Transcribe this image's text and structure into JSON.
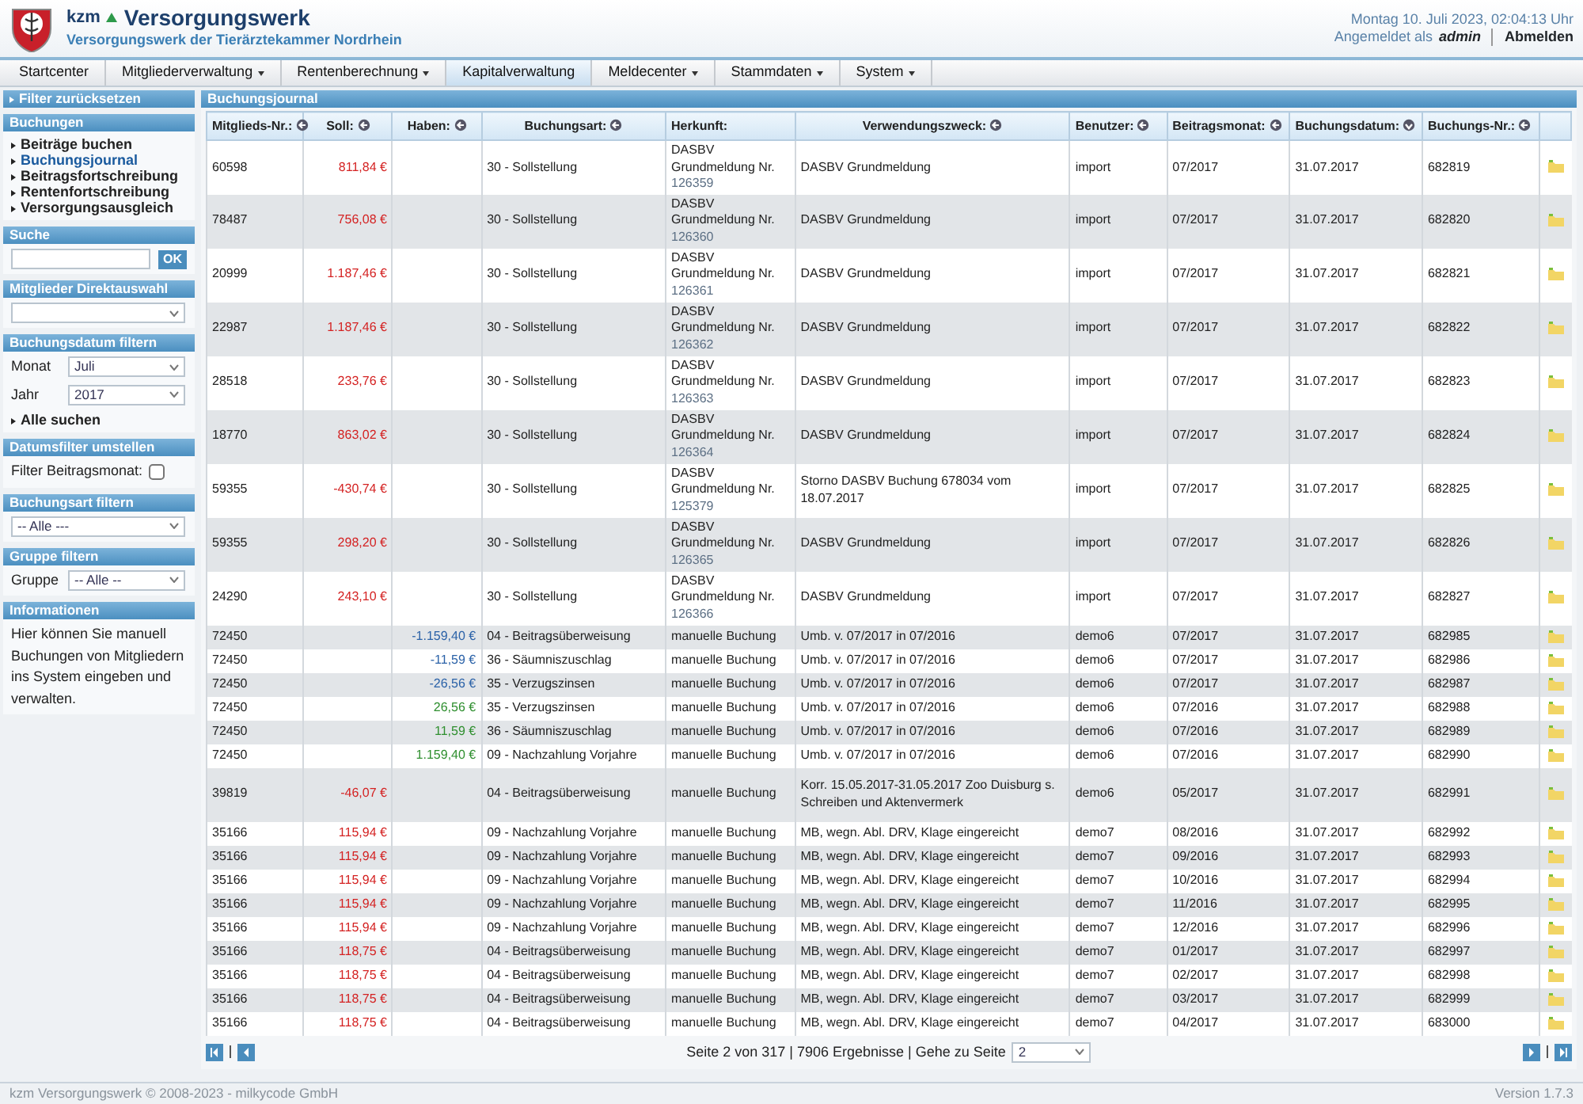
{
  "header": {
    "brand_short": "kzm",
    "brand_name": "Versorgungswerk",
    "subtitle": "Versorgungswerk der Tierärztekammer Nordrhein",
    "datetime": "Montag 10. Juli 2023, 02:04:13 Uhr",
    "login_label": "Angemeldet als",
    "login_user": "admin",
    "logout": "Abmelden"
  },
  "nav": [
    {
      "label": "Startcenter",
      "has_menu": false,
      "selected": false
    },
    {
      "label": "Mitgliederverwaltung",
      "has_menu": true,
      "selected": false
    },
    {
      "label": "Rentenberechnung",
      "has_menu": true,
      "selected": false
    },
    {
      "label": "Kapitalverwaltung",
      "has_menu": false,
      "selected": true
    },
    {
      "label": "Meldecenter",
      "has_menu": true,
      "selected": false
    },
    {
      "label": "Stammdaten",
      "has_menu": true,
      "selected": false
    },
    {
      "label": "System",
      "has_menu": true,
      "selected": false
    }
  ],
  "sidebar": {
    "reset": "Filter zurücksetzen",
    "sections": [
      {
        "kind": "links",
        "title": "Buchungen",
        "items": [
          {
            "label": "Beiträge buchen",
            "selected": false
          },
          {
            "label": "Buchungsjournal",
            "selected": true
          },
          {
            "label": "Beitragsfortschreibung",
            "selected": false
          },
          {
            "label": "Rentenfortschreibung",
            "selected": false
          },
          {
            "label": "Versorgungsausgleich",
            "selected": false
          }
        ]
      },
      {
        "kind": "search",
        "title": "Suche",
        "button": "OK"
      },
      {
        "kind": "combo",
        "title": "Mitglieder Direktauswahl"
      },
      {
        "kind": "date",
        "title": "Buchungsdatum filtern",
        "fields": [
          {
            "label": "Monat",
            "value": "Juli"
          },
          {
            "label": "Jahr",
            "value": "2017"
          }
        ],
        "link": "Alle suchen"
      },
      {
        "kind": "checkbox",
        "title": "Datumsfilter umstellen",
        "label": "Filter Beitragsmonat:",
        "checked": false
      },
      {
        "kind": "select",
        "title": "Buchungsart filtern",
        "value": "-- Alle ---"
      },
      {
        "kind": "labeled_select",
        "title": "Gruppe filtern",
        "label": "Gruppe",
        "value": "-- Alle --"
      },
      {
        "kind": "text",
        "title": "Informationen",
        "text": "Hier können Sie manuell Buchungen von Mitgliedern ins System eingeben und verwalten."
      }
    ]
  },
  "journal": {
    "title": "Buchungsjournal",
    "columns": [
      {
        "label": "Mitglieds-Nr.:",
        "kind": "sortable"
      },
      {
        "label": "Soll:",
        "kind": "sortable"
      },
      {
        "label": "Haben:",
        "kind": "sortable"
      },
      {
        "label": "Buchungsart:",
        "kind": "sortable"
      },
      {
        "label": "Herkunft:",
        "kind": "plain"
      },
      {
        "label": "Verwendungszweck:",
        "kind": "sortable"
      },
      {
        "label": "Benutzer:",
        "kind": "sortable"
      },
      {
        "label": "Beitragsmonat:",
        "kind": "sortable"
      },
      {
        "label": "Buchungsdatum:",
        "kind": "sorted"
      },
      {
        "label": "Buchungs-Nr.:",
        "kind": "sortable"
      }
    ],
    "rows": [
      {
        "member": "60598",
        "debit": "811,84 €",
        "type": "30 - Sollstellung",
        "origin": "DASBV Grundmeldung Nr.",
        "origin_ref": "126359",
        "purpose": "DASBV Grundmeldung",
        "user": "import",
        "month": "07/2017",
        "date": "31.07.2017",
        "number": "682819"
      },
      {
        "member": "78487",
        "debit": "756,08 €",
        "type": "30 - Sollstellung",
        "origin": "DASBV Grundmeldung Nr.",
        "origin_ref": "126360",
        "purpose": "DASBV Grundmeldung",
        "user": "import",
        "month": "07/2017",
        "date": "31.07.2017",
        "number": "682820"
      },
      {
        "member": "20999",
        "debit": "1.187,46 €",
        "type": "30 - Sollstellung",
        "origin": "DASBV Grundmeldung Nr.",
        "origin_ref": "126361",
        "purpose": "DASBV Grundmeldung",
        "user": "import",
        "month": "07/2017",
        "date": "31.07.2017",
        "number": "682821"
      },
      {
        "member": "22987",
        "debit": "1.187,46 €",
        "type": "30 - Sollstellung",
        "origin": "DASBV Grundmeldung Nr.",
        "origin_ref": "126362",
        "purpose": "DASBV Grundmeldung",
        "user": "import",
        "month": "07/2017",
        "date": "31.07.2017",
        "number": "682822"
      },
      {
        "member": "28518",
        "debit": "233,76 €",
        "type": "30 - Sollstellung",
        "origin": "DASBV Grundmeldung Nr.",
        "origin_ref": "126363",
        "purpose": "DASBV Grundmeldung",
        "user": "import",
        "month": "07/2017",
        "date": "31.07.2017",
        "number": "682823"
      },
      {
        "member": "18770",
        "debit": "863,02 €",
        "type": "30 - Sollstellung",
        "origin": "DASBV Grundmeldung Nr.",
        "origin_ref": "126364",
        "purpose": "DASBV Grundmeldung",
        "user": "import",
        "month": "07/2017",
        "date": "31.07.2017",
        "number": "682824"
      },
      {
        "member": "59355",
        "debit": "-430,74 €",
        "type": "30 - Sollstellung",
        "origin": "DASBV Grundmeldung Nr.",
        "origin_ref": "125379",
        "purpose": "Storno DASBV Buchung 678034 vom 18.07.2017",
        "user": "import",
        "month": "07/2017",
        "date": "31.07.2017",
        "number": "682825"
      },
      {
        "member": "59355",
        "debit": "298,20 €",
        "type": "30 - Sollstellung",
        "origin": "DASBV Grundmeldung Nr.",
        "origin_ref": "126365",
        "purpose": "DASBV Grundmeldung",
        "user": "import",
        "month": "07/2017",
        "date": "31.07.2017",
        "number": "682826"
      },
      {
        "member": "24290",
        "debit": "243,10 €",
        "type": "30 - Sollstellung",
        "origin": "DASBV Grundmeldung Nr.",
        "origin_ref": "126366",
        "purpose": "DASBV Grundmeldung",
        "user": "import",
        "month": "07/2017",
        "date": "31.07.2017",
        "number": "682827"
      },
      {
        "member": "72450",
        "credit": "-1.159,40 €",
        "color": "#2b62a8",
        "type": "04 - Beitragsüberweisung",
        "origin": "manuelle Buchung",
        "purpose": "Umb. v. 07/2017 in 07/2016",
        "user": "demo6",
        "month": "07/2017",
        "date": "31.07.2017",
        "number": "682985"
      },
      {
        "member": "72450",
        "credit": "-11,59 €",
        "color": "#2b62a8",
        "type": "36 - Säumniszuschlag",
        "origin": "manuelle Buchung",
        "purpose": "Umb. v. 07/2017 in 07/2016",
        "user": "demo6",
        "month": "07/2017",
        "date": "31.07.2017",
        "number": "682986"
      },
      {
        "member": "72450",
        "credit": "-26,56 €",
        "color": "#2b62a8",
        "type": "35 - Verzugszinsen",
        "origin": "manuelle Buchung",
        "purpose": "Umb. v. 07/2017 in 07/2016",
        "user": "demo6",
        "month": "07/2017",
        "date": "31.07.2017",
        "number": "682987"
      },
      {
        "member": "72450",
        "credit": "26,56 €",
        "color": "#2f8f2f",
        "type": "35 - Verzugszinsen",
        "origin": "manuelle Buchung",
        "purpose": "Umb. v. 07/2017 in 07/2016",
        "user": "demo6",
        "month": "07/2016",
        "date": "31.07.2017",
        "number": "682988"
      },
      {
        "member": "72450",
        "credit": "11,59 €",
        "color": "#2f8f2f",
        "type": "36 - Säumniszuschlag",
        "origin": "manuelle Buchung",
        "purpose": "Umb. v. 07/2017 in 07/2016",
        "user": "demo6",
        "month": "07/2016",
        "date": "31.07.2017",
        "number": "682989"
      },
      {
        "member": "72450",
        "credit": "1.159,40 €",
        "color": "#2f8f2f",
        "type": "09 - Nachzahlung Vorjahre",
        "origin": "manuelle Buchung",
        "purpose": "Umb. v. 07/2017 in 07/2016",
        "user": "demo6",
        "month": "07/2016",
        "date": "31.07.2017",
        "number": "682990"
      },
      {
        "member": "39819",
        "debit": "-46,07 €",
        "type": "04 - Beitragsüberweisung",
        "origin": "manuelle Buchung",
        "purpose": "Korr. 15.05.2017-31.05.2017 Zoo Duisburg s. Schreiben und Aktenvermerk",
        "user": "demo6",
        "month": "05/2017",
        "date": "31.07.2017",
        "number": "682991"
      },
      {
        "member": "35166",
        "debit": "115,94 €",
        "type": "09 - Nachzahlung Vorjahre",
        "origin": "manuelle Buchung",
        "purpose": "MB, wegn. Abl. DRV, Klage eingereicht",
        "user": "demo7",
        "month": "08/2016",
        "date": "31.07.2017",
        "number": "682992"
      },
      {
        "member": "35166",
        "debit": "115,94 €",
        "type": "09 - Nachzahlung Vorjahre",
        "origin": "manuelle Buchung",
        "purpose": "MB, wegn. Abl. DRV, Klage eingereicht",
        "user": "demo7",
        "month": "09/2016",
        "date": "31.07.2017",
        "number": "682993"
      },
      {
        "member": "35166",
        "debit": "115,94 €",
        "type": "09 - Nachzahlung Vorjahre",
        "origin": "manuelle Buchung",
        "purpose": "MB, wegn. Abl. DRV, Klage eingereicht",
        "user": "demo7",
        "month": "10/2016",
        "date": "31.07.2017",
        "number": "682994"
      },
      {
        "member": "35166",
        "debit": "115,94 €",
        "type": "09 - Nachzahlung Vorjahre",
        "origin": "manuelle Buchung",
        "purpose": "MB, wegn. Abl. DRV, Klage eingereicht",
        "user": "demo7",
        "month": "11/2016",
        "date": "31.07.2017",
        "number": "682995"
      },
      {
        "member": "35166",
        "debit": "115,94 €",
        "type": "09 - Nachzahlung Vorjahre",
        "origin": "manuelle Buchung",
        "purpose": "MB, wegn. Abl. DRV, Klage eingereicht",
        "user": "demo7",
        "month": "12/2016",
        "date": "31.07.2017",
        "number": "682996"
      },
      {
        "member": "35166",
        "debit": "118,75 €",
        "type": "04 - Beitragsüberweisung",
        "origin": "manuelle Buchung",
        "purpose": "MB, wegn. Abl. DRV, Klage eingereicht",
        "user": "demo7",
        "month": "01/2017",
        "date": "31.07.2017",
        "number": "682997"
      },
      {
        "member": "35166",
        "debit": "118,75 €",
        "type": "04 - Beitragsüberweisung",
        "origin": "manuelle Buchung",
        "purpose": "MB, wegn. Abl. DRV, Klage eingereicht",
        "user": "demo7",
        "month": "02/2017",
        "date": "31.07.2017",
        "number": "682998"
      },
      {
        "member": "35166",
        "debit": "118,75 €",
        "type": "04 - Beitragsüberweisung",
        "origin": "manuelle Buchung",
        "purpose": "MB, wegn. Abl. DRV, Klage eingereicht",
        "user": "demo7",
        "month": "03/2017",
        "date": "31.07.2017",
        "number": "682999"
      },
      {
        "member": "35166",
        "debit": "118,75 €",
        "type": "04 - Beitragsüberweisung",
        "origin": "manuelle Buchung",
        "purpose": "MB, wegn. Abl. DRV, Klage eingereicht",
        "user": "demo7",
        "month": "04/2017",
        "date": "31.07.2017",
        "number": "683000"
      }
    ],
    "pager": {
      "summary": "Seite 2 von 317 | 7906 Ergebnisse | Gehe zu Seite",
      "page": "2"
    }
  },
  "footer": {
    "copyright": "kzm Versorgungswerk © 2008-2023 - milkycode GmbH",
    "version": "Version 1.7.3"
  }
}
